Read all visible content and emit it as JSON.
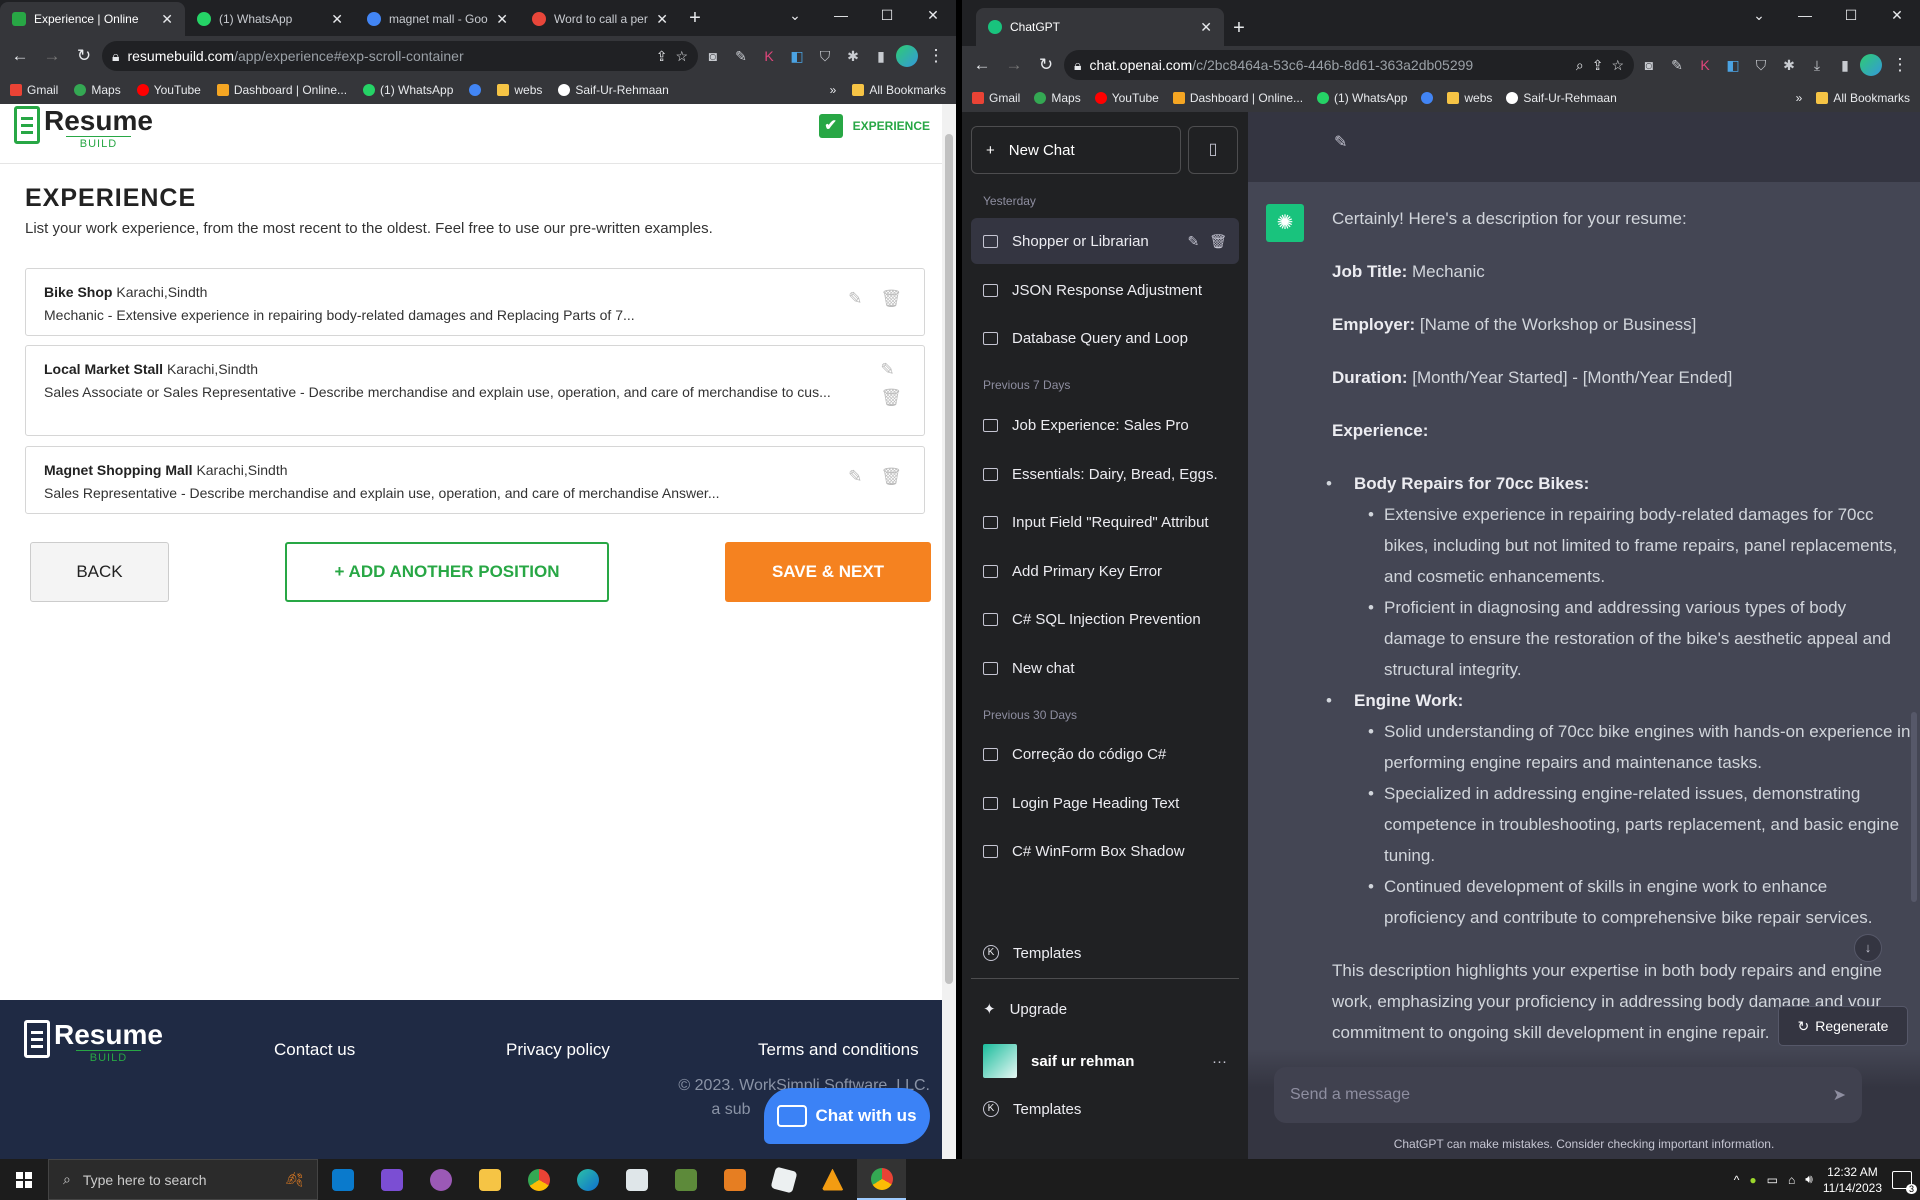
{
  "left_browser": {
    "tabs": [
      {
        "title": "Experience | Online",
        "active": true,
        "color": "#28a745"
      },
      {
        "title": "(1) WhatsApp",
        "active": false,
        "color": "#25d366"
      },
      {
        "title": "magnet mall - Goo",
        "active": false,
        "color": "#4285f4"
      },
      {
        "title": "Word to call a pers",
        "active": false,
        "color": "#e8463a"
      }
    ],
    "url_host": "resumebuild.com",
    "url_path": "/app/experience#exp-scroll-container",
    "bookmarks": [
      "Gmail",
      "Maps",
      "YouTube",
      "Dashboard | Online...",
      "(1) WhatsApp",
      "",
      "webs",
      "Saif-Ur-Rehmaan"
    ],
    "all_bookmarks": "All Bookmarks"
  },
  "resume_page": {
    "logo_main": "Resume",
    "logo_sub": "BUILD",
    "step_label": "EXPERIENCE",
    "title": "EXPERIENCE",
    "subtitle": "List your work experience, from the most recent to the oldest. Feel free to use our pre-written examples.",
    "entries": [
      {
        "employer": "Bike Shop",
        "location": "Karachi,Sindth",
        "description": "Mechanic - Extensive experience in repairing body-related damages and Replacing Parts of 7..."
      },
      {
        "employer": "Local Market Stall",
        "location": "Karachi,Sindth",
        "description": "Sales Associate or Sales Representative - Describe merchandise and explain use, operation, and care of merchandise to cus..."
      },
      {
        "employer": "Magnet Shopping Mall",
        "location": "Karachi,Sindth",
        "description": "Sales Representative - Describe merchandise and explain use, operation, and care of merchandise Answer..."
      }
    ],
    "back_label": "BACK",
    "add_label": "+ ADD ANOTHER POSITION",
    "save_label": "SAVE & NEXT",
    "footer": {
      "contact": "Contact us",
      "privacy": "Privacy policy",
      "terms": "Terms and conditions",
      "copyright_1": "© 2023. WorkSimpli Software, LLC.",
      "copyright_2": "a sub"
    },
    "chat_label": "Chat with us"
  },
  "right_browser": {
    "tab_title": "ChatGPT",
    "url_host": "chat.openai.com",
    "url_path": "/c/2bc8464a-53c6-446b-8d61-363a2db05299",
    "bookmarks": [
      "Gmail",
      "Maps",
      "YouTube",
      "Dashboard | Online...",
      "(1) WhatsApp",
      "",
      "webs",
      "Saif-Ur-Rehmaan"
    ],
    "all_bookmarks": "All Bookmarks"
  },
  "chatgpt": {
    "new_chat": "New Chat",
    "groups": [
      {
        "label": "Yesterday",
        "items": [
          "Shopper or Librarian",
          "JSON Response Adjustment",
          "Database Query and Loop"
        ]
      },
      {
        "label": "Previous 7 Days",
        "items": [
          "Job Experience: Sales Pro",
          "Essentials: Dairy, Bread, Eggs.",
          "Input Field \"Required\" Attribut",
          "Add Primary Key Error",
          "C# SQL Injection Prevention",
          "New chat"
        ]
      },
      {
        "label": "Previous 30 Days",
        "items": [
          "Correção do código C#",
          "Login Page Heading Text",
          "C# WinForm Box Shadow"
        ]
      }
    ],
    "templates": "Templates",
    "upgrade": "Upgrade",
    "user_name": "saif ur rehman",
    "templates_2": "Templates",
    "message": {
      "intro": "Certainly! Here's a description for your resume:",
      "job_title_label": "Job Title:",
      "job_title": "Mechanic",
      "employer_label": "Employer:",
      "employer": "[Name of the Workshop or Business]",
      "duration_label": "Duration:",
      "duration": "[Month/Year Started] - [Month/Year Ended]",
      "experience_label": "Experience:",
      "section1_title": "Body Repairs for 70cc Bikes:",
      "section1_items": [
        "Extensive experience in repairing body-related damages for 70cc bikes, including but not limited to frame repairs, panel replacements, and cosmetic enhancements.",
        "Proficient in diagnosing and addressing various types of body damage to ensure the restoration of the bike's aesthetic appeal and structural integrity."
      ],
      "section2_title": "Engine Work:",
      "section2_items": [
        "Solid understanding of 70cc bike engines with hands-on experience in performing engine repairs and maintenance tasks.",
        "Specialized in addressing engine-related issues, demonstrating competence in troubleshooting, parts replacement, and basic engine tuning.",
        "Continued development of skills in engine work to enhance proficiency and contribute to comprehensive bike repair services."
      ],
      "summary": "This description highlights your expertise in both body repairs and engine work, emphasizing your proficiency in addressing body damage and your commitment to ongoing skill development in engine repair."
    },
    "regenerate": "Regenerate",
    "input_placeholder": "Send a message",
    "disclaimer": "ChatGPT can make mistakes. Consider checking important information."
  },
  "taskbar": {
    "search_placeholder": "Type here to search",
    "time": "12:32 AM",
    "date": "11/14/2023",
    "notifications": "3"
  }
}
